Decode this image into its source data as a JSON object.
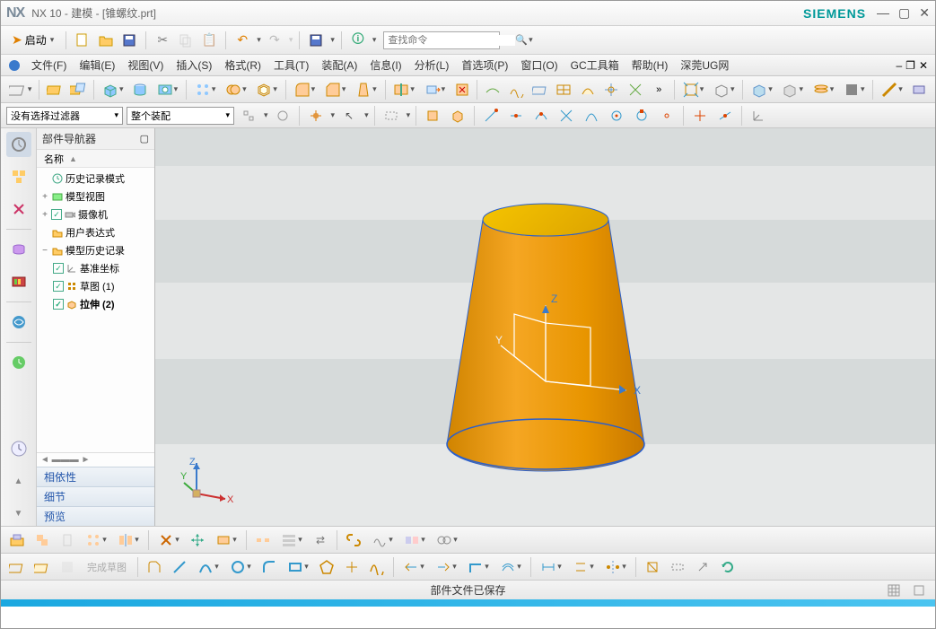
{
  "title": "NX 10 - 建模 - [锥螺纹.prt]",
  "brand": "SIEMENS",
  "start_label": "启动",
  "search_placeholder": "查找命令",
  "menus": [
    "文件(F)",
    "编辑(E)",
    "视图(V)",
    "插入(S)",
    "格式(R)",
    "工具(T)",
    "装配(A)",
    "信息(I)",
    "分析(L)",
    "首选项(P)",
    "窗口(O)",
    "GC工具箱",
    "帮助(H)",
    "深莞UG网"
  ],
  "filter_combo": "没有选择过滤器",
  "assembly_combo": "整个装配",
  "nav_title": "部件导航器",
  "nav_col": "名称",
  "tree": {
    "n0": "历史记录模式",
    "n1": "模型视图",
    "n2": "摄像机",
    "n3": "用户表达式",
    "n4": "模型历史记录",
    "n5": "基准坐标",
    "n6": "草图 (1)",
    "n7": "拉伸 (2)"
  },
  "sections": {
    "s0": "相依性",
    "s1": "细节",
    "s2": "预览"
  },
  "sketch_done": "完成草图",
  "status": "部件文件已保存",
  "axes": {
    "x": "X",
    "y": "Y",
    "z": "Z"
  }
}
